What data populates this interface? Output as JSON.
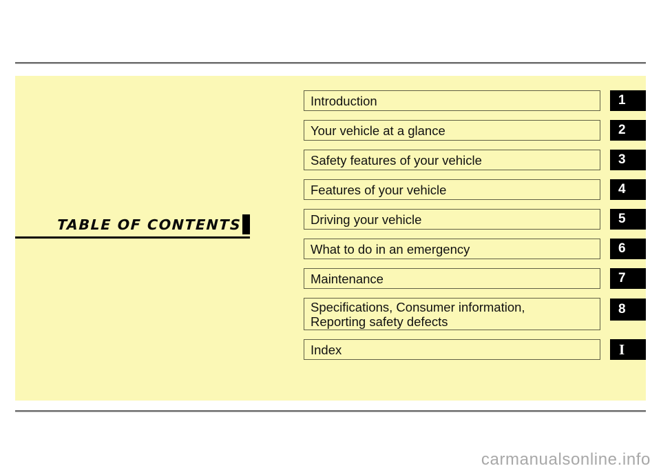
{
  "page": {
    "title": "TABLE  OF  CONTENTS",
    "panel_color": "#fbf8b6",
    "rule_color": "#6a6a6a",
    "tab_color": "#000000",
    "tab_text_color": "#ffffff"
  },
  "toc": {
    "rows": [
      {
        "label": "Introduction",
        "tab": "1",
        "tab_style": "sans",
        "lines": 1
      },
      {
        "label": "Your vehicle at a glance",
        "tab": "2",
        "tab_style": "sans",
        "lines": 1
      },
      {
        "label": "Safety features of your vehicle",
        "tab": "3",
        "tab_style": "sans",
        "lines": 1
      },
      {
        "label": "Features of your vehicle",
        "tab": "4",
        "tab_style": "sans",
        "lines": 1
      },
      {
        "label": "Driving your vehicle",
        "tab": "5",
        "tab_style": "sans",
        "lines": 1
      },
      {
        "label": "What to do in an emergency",
        "tab": "6",
        "tab_style": "sans",
        "lines": 1
      },
      {
        "label": "Maintenance",
        "tab": "7",
        "tab_style": "sans",
        "lines": 1
      },
      {
        "label": "Specifications, Consumer information,\nReporting safety defects",
        "tab": "8",
        "tab_style": "sans",
        "lines": 2
      },
      {
        "label": "Index",
        "tab": "I",
        "tab_style": "serif",
        "lines": 1
      }
    ]
  },
  "watermark": {
    "text": "carmanualsonline.info",
    "color": "#a8a8a8"
  }
}
